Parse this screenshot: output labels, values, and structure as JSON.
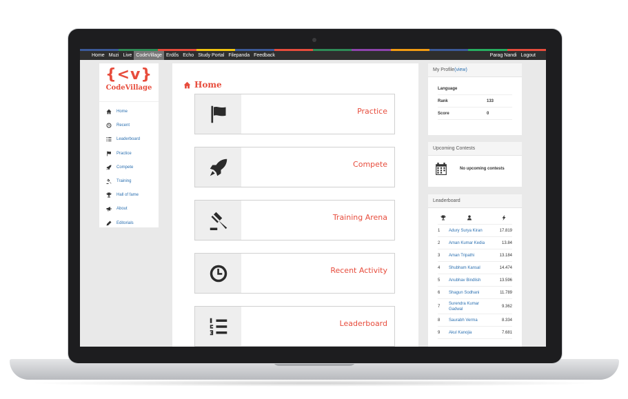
{
  "topnav": {
    "items": [
      {
        "label": "Home"
      },
      {
        "label": "Muzi"
      },
      {
        "label": "Live"
      },
      {
        "label": "CodeVillage"
      },
      {
        "label": "Erdős"
      },
      {
        "label": "Echo"
      },
      {
        "label": "Study Portal"
      },
      {
        "label": "Filepanda"
      },
      {
        "label": "Feedback"
      }
    ],
    "active_index": 3,
    "user_name": "Parag Nandi",
    "logout_label": "Logout"
  },
  "color_strip": [
    "#3b5998",
    "#2e8b57",
    "#e74c3c",
    "#f1c40f",
    "#3b5998",
    "#e74c3c",
    "#2e8b57",
    "#8e44ad",
    "#f39c12",
    "#3b5998",
    "#27ae60",
    "#e74c3c"
  ],
  "logo": {
    "mark": "{<v}",
    "text": "CodeVillage",
    "color": "#e74c3c"
  },
  "sidebar": {
    "items": [
      {
        "label": "Home",
        "icon": "home-icon"
      },
      {
        "label": "Recent",
        "icon": "clock-icon"
      },
      {
        "label": "Leaderboard",
        "icon": "list-icon"
      },
      {
        "label": "Practice",
        "icon": "flag-icon"
      },
      {
        "label": "Compete",
        "icon": "rocket-icon"
      },
      {
        "label": "Training",
        "icon": "gavel-icon"
      },
      {
        "label": "Hall of fame",
        "icon": "trophy-icon"
      },
      {
        "label": "About",
        "icon": "megaphone-icon"
      },
      {
        "label": "Editorials",
        "icon": "pencil-icon"
      }
    ]
  },
  "main": {
    "title": "Home",
    "cards": [
      {
        "label": "Practice",
        "icon": "flag-icon"
      },
      {
        "label": "Compete",
        "icon": "rocket-icon"
      },
      {
        "label": "Training Arena",
        "icon": "gavel-icon"
      },
      {
        "label": "Recent Activity",
        "icon": "clock-icon"
      },
      {
        "label": "Leaderboard",
        "icon": "ordered-list-icon"
      }
    ]
  },
  "profile": {
    "title": "My Profile",
    "view_label": "(view)",
    "rows": [
      {
        "key": "Language",
        "value": ""
      },
      {
        "key": "Rank",
        "value": "133"
      },
      {
        "key": "Score",
        "value": "0"
      }
    ]
  },
  "contests": {
    "title": "Upcoming Contests",
    "empty_text": "No upcoming contests"
  },
  "leaderboard": {
    "title": "Leaderboard",
    "rows": [
      {
        "rank": "1",
        "name": "Adury Surya Kiran",
        "score": "17.819"
      },
      {
        "rank": "2",
        "name": "Aman Kumar Kedia",
        "score": "13.84"
      },
      {
        "rank": "3",
        "name": "Aman Tripathi",
        "score": "13.184"
      },
      {
        "rank": "4",
        "name": "Shubham Kansal",
        "score": "14.474"
      },
      {
        "rank": "5",
        "name": "Anubhav Bindlish",
        "score": "13.596"
      },
      {
        "rank": "6",
        "name": "Shagun Sodhani",
        "score": "11.789"
      },
      {
        "rank": "7",
        "name": "Surendra Kumar Gadwal",
        "score": "9.362"
      },
      {
        "rank": "8",
        "name": "Saurabh Verma",
        "score": "8.334"
      },
      {
        "rank": "9",
        "name": "Akul Kanojia",
        "score": "7.681"
      }
    ]
  }
}
